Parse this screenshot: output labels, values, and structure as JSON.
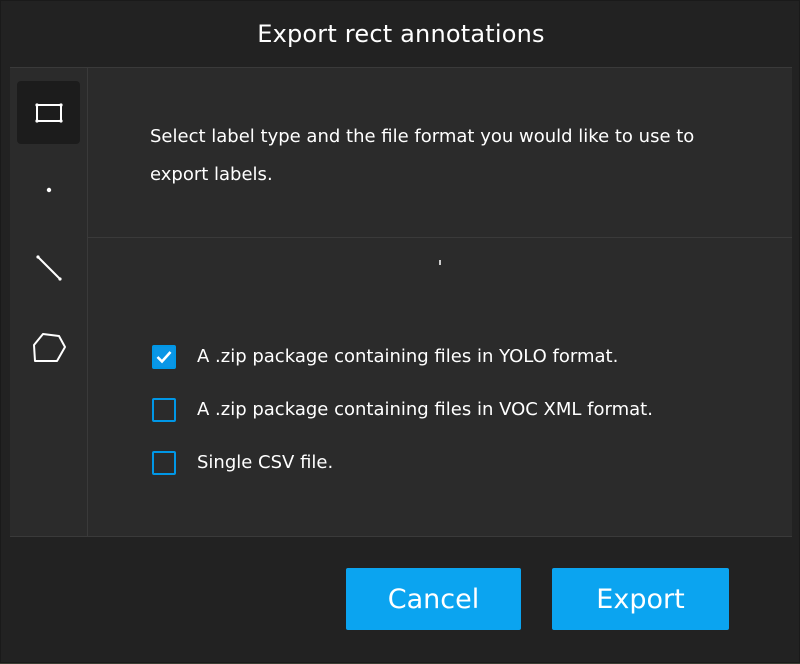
{
  "dialog": {
    "title": "Export rect annotations"
  },
  "toolbox": {
    "tools": [
      {
        "name": "rect",
        "icon": "rectangle-icon",
        "active": true
      },
      {
        "name": "point",
        "icon": "point-icon",
        "active": false
      },
      {
        "name": "line",
        "icon": "line-icon",
        "active": false
      },
      {
        "name": "polygon",
        "icon": "polygon-icon",
        "active": false
      }
    ]
  },
  "main": {
    "description": "Select label type and the file format you would like to use to export labels.",
    "options": [
      {
        "label": "A .zip package containing files in YOLO format.",
        "checked": true
      },
      {
        "label": "A .zip package containing files in VOC XML format.",
        "checked": false
      },
      {
        "label": "Single CSV file.",
        "checked": false
      }
    ]
  },
  "footer": {
    "cancel_label": "Cancel",
    "export_label": "Export"
  },
  "colors": {
    "accent": "#0ba4f0",
    "dialog_bg": "#222222",
    "panel_bg": "#2b2b2b",
    "checkbox_border": "#0097e6"
  }
}
